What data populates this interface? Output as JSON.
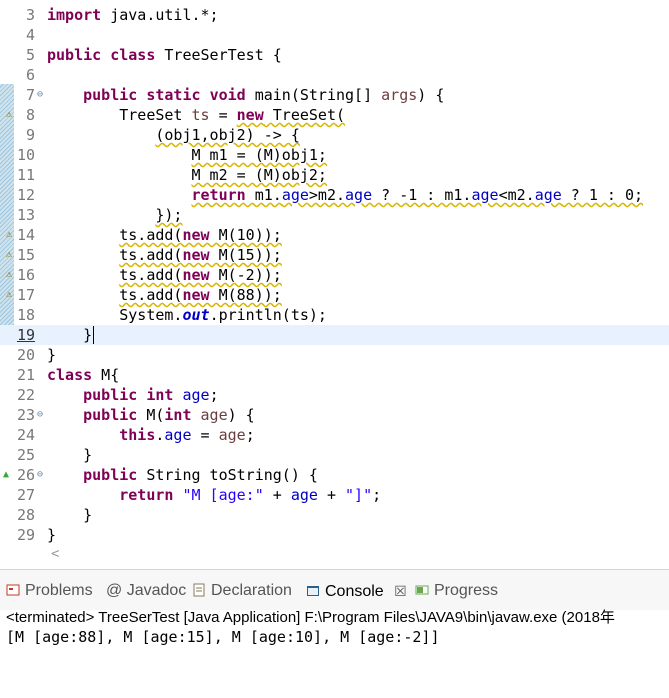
{
  "editor": {
    "lines": [
      {
        "n": "3",
        "segs": [
          {
            "t": "import",
            "c": "kw"
          },
          {
            "t": " java.util.*;"
          }
        ]
      },
      {
        "n": "4",
        "segs": []
      },
      {
        "n": "5",
        "segs": [
          {
            "t": "public",
            "c": "kw"
          },
          {
            "t": " "
          },
          {
            "t": "class",
            "c": "kw"
          },
          {
            "t": " TreeSerTest {"
          }
        ]
      },
      {
        "n": "6",
        "segs": []
      },
      {
        "n": "7",
        "fold": true,
        "segs": [
          {
            "t": "    "
          },
          {
            "t": "public",
            "c": "kw"
          },
          {
            "t": " "
          },
          {
            "t": "static",
            "c": "kw"
          },
          {
            "t": " "
          },
          {
            "t": "void",
            "c": "kw"
          },
          {
            "t": " main(String[] "
          },
          {
            "t": "args",
            "c": "param"
          },
          {
            "t": ") {"
          }
        ]
      },
      {
        "n": "8",
        "marker": true,
        "segs": [
          {
            "t": "        TreeSet "
          },
          {
            "t": "ts",
            "c": "param"
          },
          {
            "t": " = "
          },
          {
            "t": "new",
            "c": "kw wavy"
          },
          {
            "t": " TreeSet(",
            "c": "wavy"
          }
        ]
      },
      {
        "n": "9",
        "segs": [
          {
            "t": "            "
          },
          {
            "t": "(obj1,obj2) -> {",
            "c": "wavy"
          }
        ]
      },
      {
        "n": "10",
        "segs": [
          {
            "t": "                "
          },
          {
            "t": "M m1 = (M)obj1;",
            "c": "wavy"
          }
        ]
      },
      {
        "n": "11",
        "segs": [
          {
            "t": "                "
          },
          {
            "t": "M m2 = (M)obj2;",
            "c": "wavy"
          }
        ]
      },
      {
        "n": "12",
        "segs": [
          {
            "t": "                "
          },
          {
            "t": "return",
            "c": "kw wavy"
          },
          {
            "t": " m1.",
            "c": "wavy"
          },
          {
            "t": "age",
            "c": "fld wavy"
          },
          {
            "t": ">m2.",
            "c": "wavy"
          },
          {
            "t": "age",
            "c": "fld wavy"
          },
          {
            "t": " ? -1 : m1.",
            "c": "wavy"
          },
          {
            "t": "age",
            "c": "fld wavy"
          },
          {
            "t": "<m2.",
            "c": "wavy"
          },
          {
            "t": "age",
            "c": "fld wavy"
          },
          {
            "t": " ? 1 : 0;",
            "c": "wavy"
          }
        ]
      },
      {
        "n": "13",
        "segs": [
          {
            "t": "            "
          },
          {
            "t": "});",
            "c": "wavy"
          }
        ]
      },
      {
        "n": "14",
        "marker": true,
        "segs": [
          {
            "t": "        "
          },
          {
            "t": "ts.add(",
            "c": "wavy"
          },
          {
            "t": "new",
            "c": "kw wavy"
          },
          {
            "t": " M(10));",
            "c": "wavy"
          }
        ]
      },
      {
        "n": "15",
        "marker": true,
        "segs": [
          {
            "t": "        "
          },
          {
            "t": "ts.add(",
            "c": "wavy"
          },
          {
            "t": "new",
            "c": "kw wavy"
          },
          {
            "t": " M(15));",
            "c": "wavy"
          }
        ]
      },
      {
        "n": "16",
        "marker": true,
        "segs": [
          {
            "t": "        "
          },
          {
            "t": "ts.add(",
            "c": "wavy"
          },
          {
            "t": "new",
            "c": "kw wavy"
          },
          {
            "t": " M(-2));",
            "c": "wavy"
          }
        ]
      },
      {
        "n": "17",
        "marker": true,
        "segs": [
          {
            "t": "        "
          },
          {
            "t": "ts.add(",
            "c": "wavy"
          },
          {
            "t": "new",
            "c": "kw wavy"
          },
          {
            "t": " M(88));",
            "c": "wavy"
          }
        ]
      },
      {
        "n": "18",
        "segs": [
          {
            "t": "        System."
          },
          {
            "t": "out",
            "c": "sfld"
          },
          {
            "t": ".println(ts);"
          }
        ]
      },
      {
        "n": "19",
        "current": true,
        "segs": [
          {
            "t": "    }"
          }
        ]
      },
      {
        "n": "20",
        "segs": [
          {
            "t": "}"
          }
        ]
      },
      {
        "n": "21",
        "segs": [
          {
            "t": "class",
            "c": "kw"
          },
          {
            "t": " M{"
          }
        ]
      },
      {
        "n": "22",
        "segs": [
          {
            "t": "    "
          },
          {
            "t": "public",
            "c": "kw"
          },
          {
            "t": " "
          },
          {
            "t": "int",
            "c": "kw"
          },
          {
            "t": " "
          },
          {
            "t": "age",
            "c": "fld"
          },
          {
            "t": ";"
          }
        ]
      },
      {
        "n": "23",
        "fold": true,
        "segs": [
          {
            "t": "    "
          },
          {
            "t": "public",
            "c": "kw"
          },
          {
            "t": " M("
          },
          {
            "t": "int",
            "c": "kw"
          },
          {
            "t": " "
          },
          {
            "t": "age",
            "c": "param"
          },
          {
            "t": ") {"
          }
        ]
      },
      {
        "n": "24",
        "segs": [
          {
            "t": "        "
          },
          {
            "t": "this",
            "c": "kw"
          },
          {
            "t": "."
          },
          {
            "t": "age",
            "c": "fld"
          },
          {
            "t": " = "
          },
          {
            "t": "age",
            "c": "param"
          },
          {
            "t": ";"
          }
        ]
      },
      {
        "n": "25",
        "segs": [
          {
            "t": "    }"
          }
        ]
      },
      {
        "n": "26",
        "fold": true,
        "override": true,
        "segs": [
          {
            "t": "    "
          },
          {
            "t": "public",
            "c": "kw"
          },
          {
            "t": " String toString() {"
          }
        ]
      },
      {
        "n": "27",
        "segs": [
          {
            "t": "        "
          },
          {
            "t": "return",
            "c": "kw"
          },
          {
            "t": " "
          },
          {
            "t": "\"M [age:\"",
            "c": "str"
          },
          {
            "t": " + "
          },
          {
            "t": "age",
            "c": "fld"
          },
          {
            "t": " + "
          },
          {
            "t": "\"]\"",
            "c": "str"
          },
          {
            "t": ";"
          }
        ]
      },
      {
        "n": "28",
        "segs": [
          {
            "t": "    }"
          }
        ]
      },
      {
        "n": "29",
        "segs": [
          {
            "t": "}"
          }
        ]
      }
    ]
  },
  "views": {
    "tabs": [
      {
        "label": "Problems",
        "icon": "problems-icon",
        "active": false
      },
      {
        "label": "@ Javadoc",
        "icon": "javadoc-icon",
        "active": false
      },
      {
        "label": "Declaration",
        "icon": "declaration-icon",
        "active": false
      },
      {
        "label": "Console",
        "icon": "console-icon",
        "active": true
      },
      {
        "label": "Progress",
        "icon": "progress-icon",
        "active": false
      }
    ],
    "close_glyph": "☒",
    "status": "<terminated> TreeSerTest [Java Application] F:\\Program Files\\JAVA9\\bin\\javaw.exe (2018年",
    "output": "[M [age:88], M [age:15], M [age:10], M [age:-2]]"
  },
  "scroll_arrow": "<"
}
